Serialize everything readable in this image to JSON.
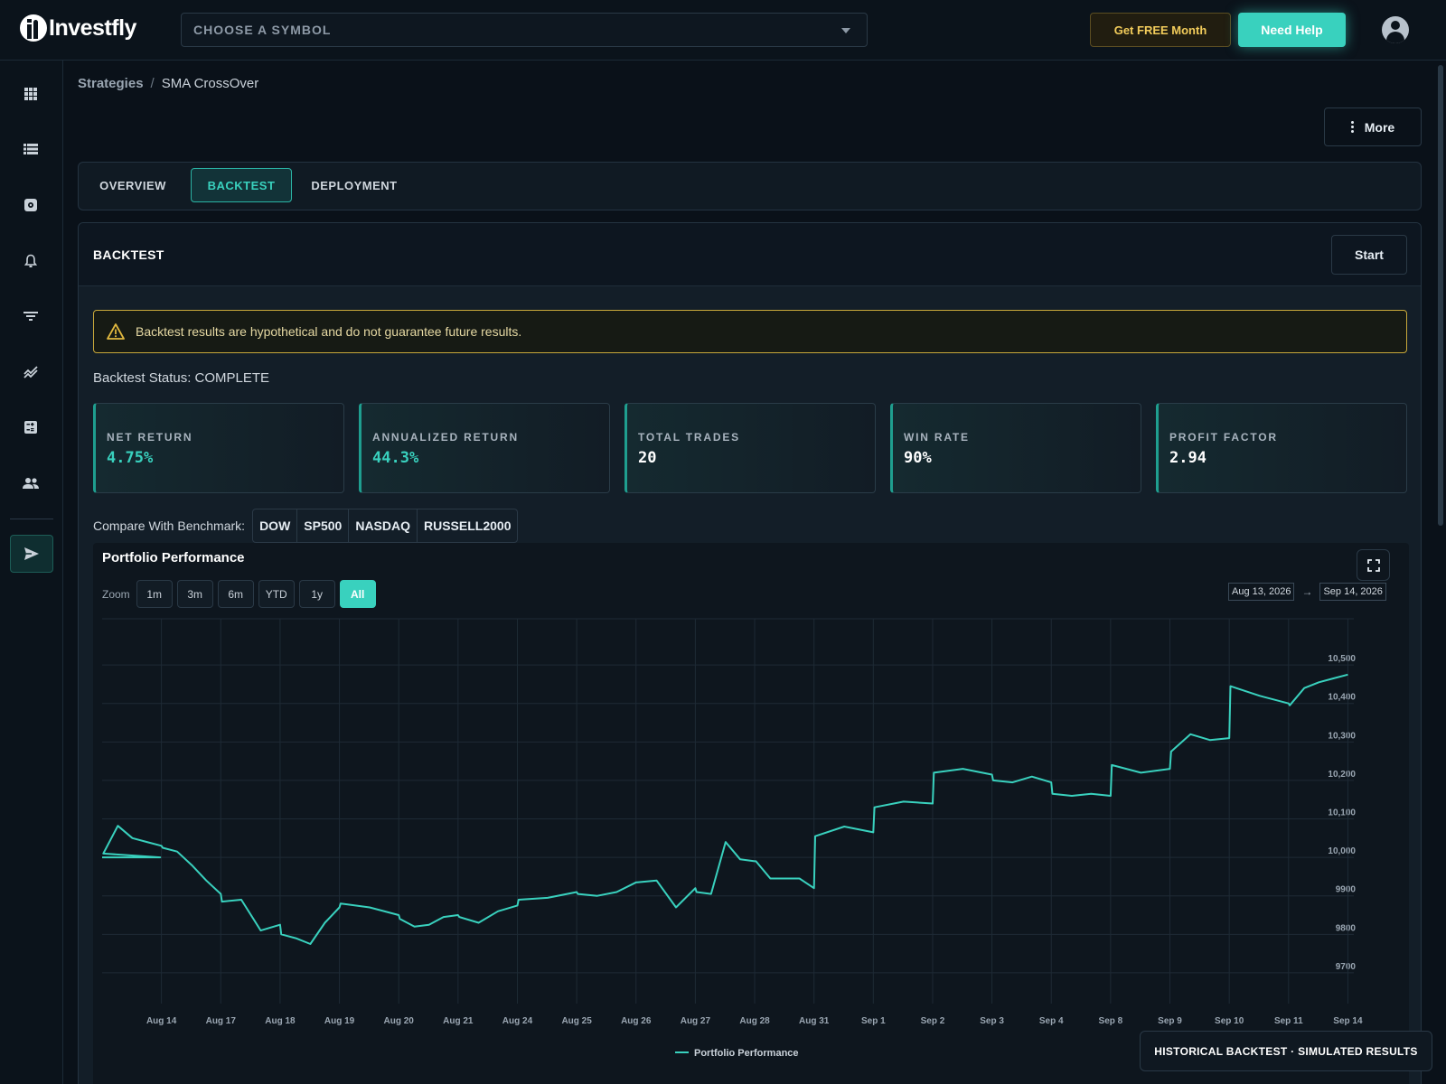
{
  "header": {
    "logo_text": "Investfly",
    "symbol_placeholder": "CHOOSE A SYMBOL",
    "free_month_label": "Get FREE Month",
    "help_label": "Need Help"
  },
  "sidebar": {
    "items": [
      "apps-icon",
      "list-icon",
      "settings-gear-icon",
      "bell-icon",
      "filter-icon",
      "trending-icon",
      "calculator-icon",
      "people-icon"
    ],
    "active": "send-icon"
  },
  "breadcrumb": {
    "parent": "Strategies",
    "separator": "/",
    "current": "SMA CrossOver"
  },
  "more_label": "More",
  "tabs": [
    {
      "label": "OVERVIEW",
      "active": false
    },
    {
      "label": "BACKTEST",
      "active": true
    },
    {
      "label": "DEPLOYMENT",
      "active": false
    }
  ],
  "backtest": {
    "title": "BACKTEST",
    "start_label": "Start",
    "alert_text": "Backtest results are hypothetical and do not guarantee future results.",
    "status_text": "Backtest Status: COMPLETE",
    "metrics": [
      {
        "label": "NET RETURN",
        "value": "4.75%",
        "positive": true
      },
      {
        "label": "ANNUALIZED RETURN",
        "value": "44.3%",
        "positive": true
      },
      {
        "label": "TOTAL TRADES",
        "value": "20",
        "positive": false
      },
      {
        "label": "WIN RATE",
        "value": "90%",
        "positive": false
      },
      {
        "label": "PROFIT FACTOR",
        "value": "2.94",
        "positive": false
      }
    ],
    "benchmark_label": "Compare With Benchmark:",
    "benchmarks": [
      "DOW",
      "SP500",
      "NASDAQ",
      "RUSSELL2000"
    ]
  },
  "chart": {
    "title": "Portfolio Performance",
    "zoom_label": "Zoom",
    "zoom_options": [
      "1m",
      "3m",
      "6m",
      "YTD",
      "1y",
      "All"
    ],
    "zoom_active": "All",
    "range_from": "Aug 13, 2026",
    "range_arrow": "→",
    "range_to": "Sep 14, 2026",
    "line_color": "#39d1be"
  },
  "chart_data": {
    "type": "line",
    "title": "Portfolio Performance",
    "x_tick_labels": [
      "Aug 14",
      "Aug 17",
      "Aug 18",
      "Aug 19",
      "Aug 20",
      "Aug 21",
      "Aug 24",
      "Aug 25",
      "Aug 26",
      "Aug 27",
      "Aug 28",
      "Aug 31",
      "Sep 1",
      "Sep 2",
      "Sep 3",
      "Sep 4",
      "Sep 8",
      "Sep 9",
      "Sep 10",
      "Sep 11",
      "Sep 14"
    ],
    "y_ticks": [
      9700,
      9800,
      9900,
      10000,
      10100,
      10200,
      10300,
      10400,
      10500
    ],
    "ylim": [
      9620,
      10620
    ],
    "grid": true,
    "legend": "bottom-center",
    "series": [
      {
        "name": "Portfolio Performance",
        "points": [
          [
            "Aug 13",
            10000
          ],
          [
            "Aug 13",
            10000
          ],
          [
            "Aug 13",
            10000
          ],
          [
            "Aug 14",
            10010
          ],
          [
            "Aug 14",
            10082
          ],
          [
            "Aug 14",
            10050
          ],
          [
            "Aug 14",
            10040
          ],
          [
            "Aug 14",
            10030
          ],
          [
            "Aug 17",
            10025
          ],
          [
            "Aug 17",
            10015
          ],
          [
            "Aug 17",
            9980
          ],
          [
            "Aug 17",
            9940
          ],
          [
            "Aug 17",
            9905
          ],
          [
            "Aug 18",
            9885
          ],
          [
            "Aug 18",
            9890
          ],
          [
            "Aug 18",
            9810
          ],
          [
            "Aug 18",
            9825
          ],
          [
            "Aug 19",
            9800
          ],
          [
            "Aug 19",
            9790
          ],
          [
            "Aug 19",
            9775
          ],
          [
            "Aug 19",
            9830
          ],
          [
            "Aug 19",
            9870
          ],
          [
            "Aug 20",
            9880
          ],
          [
            "Aug 20",
            9870
          ],
          [
            "Aug 20",
            9850
          ],
          [
            "Aug 21",
            9840
          ],
          [
            "Aug 21",
            9820
          ],
          [
            "Aug 21",
            9825
          ],
          [
            "Aug 21",
            9845
          ],
          [
            "Aug 21",
            9850
          ],
          [
            "Aug 24",
            9845
          ],
          [
            "Aug 24",
            9830
          ],
          [
            "Aug 24",
            9860
          ],
          [
            "Aug 24",
            9875
          ],
          [
            "Aug 25",
            9890
          ],
          [
            "Aug 25",
            9895
          ],
          [
            "Aug 25",
            9910
          ],
          [
            "Aug 26",
            9905
          ],
          [
            "Aug 26",
            9900
          ],
          [
            "Aug 26",
            9910
          ],
          [
            "Aug 26",
            9935
          ],
          [
            "Aug 27",
            9935
          ],
          [
            "Aug 27",
            9940
          ],
          [
            "Aug 27",
            9870
          ],
          [
            "Aug 27",
            9920
          ],
          [
            "Aug 28",
            9910
          ],
          [
            "Aug 28",
            9905
          ],
          [
            "Aug 28",
            10040
          ],
          [
            "Aug 28",
            9995
          ],
          [
            "Aug 28",
            9990
          ],
          [
            "Aug 31",
            9990
          ],
          [
            "Aug 31",
            9945
          ],
          [
            "Aug 31",
            9945
          ],
          [
            "Aug 31",
            9945
          ],
          [
            "Aug 31",
            9920
          ],
          [
            "Sep 1",
            10055
          ],
          [
            "Sep 1",
            10080
          ],
          [
            "Sep 1",
            10065
          ],
          [
            "Sep 2",
            10130
          ],
          [
            "Sep 2",
            10145
          ],
          [
            "Sep 2",
            10140
          ],
          [
            "Sep 3",
            10220
          ],
          [
            "Sep 3",
            10230
          ],
          [
            "Sep 3",
            10215
          ],
          [
            "Sep 4",
            10200
          ],
          [
            "Sep 4",
            10195
          ],
          [
            "Sep 4",
            10210
          ],
          [
            "Sep 4",
            10195
          ],
          [
            "Sep 8",
            10165
          ],
          [
            "Sep 8",
            10160
          ],
          [
            "Sep 8",
            10165
          ],
          [
            "Sep 8",
            10160
          ],
          [
            "Sep 9",
            10240
          ],
          [
            "Sep 9",
            10220
          ],
          [
            "Sep 9",
            10230
          ],
          [
            "Sep 10",
            10275
          ],
          [
            "Sep 10",
            10320
          ],
          [
            "Sep 10",
            10305
          ],
          [
            "Sep 10",
            10310
          ],
          [
            "Sep 11",
            10445
          ],
          [
            "Sep 11",
            10420
          ],
          [
            "Sep 11",
            10400
          ],
          [
            "Sep 14",
            10395
          ],
          [
            "Sep 14",
            10440
          ],
          [
            "Sep 14",
            10455
          ],
          [
            "Sep 14",
            10465
          ],
          [
            "Sep 14",
            10475
          ]
        ]
      }
    ]
  },
  "footer_badge": "HISTORICAL BACKTEST · SIMULATED RESULTS"
}
